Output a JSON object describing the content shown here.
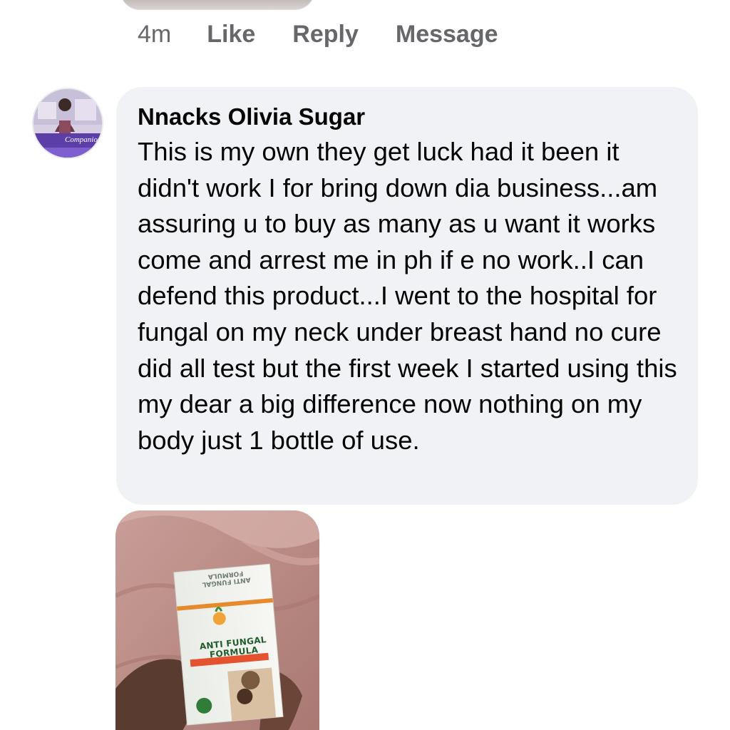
{
  "previous_comment": {
    "actions": {
      "time": "4m",
      "like": "Like",
      "reply": "Reply",
      "message": "Message"
    }
  },
  "comment": {
    "author": "Nnacks Olivia Sugar",
    "text": "This is my own they get luck had it been it didn't work I for bring down dia business...am assuring u to buy as many as u want it works come and arrest me in ph if e no work..I can defend this product...I went to the hospital for fungal on my neck under breast hand no cure did all test but the first week I started using this my dear a big difference now nothing on my body just 1 bottle of use.",
    "avatar_caption": "Companion",
    "attachment": {
      "product_label": "ANTI FUNGAL FORMULA",
      "product_label_mirrored": "ANTI FUNGAL FORMULA"
    }
  },
  "colors": {
    "bubble_bg": "#f0f2f5",
    "meta_text": "#65676b",
    "body_text": "#050505"
  },
  "icons": {
    "avatar": "profile-photo",
    "attachment": "product-photo"
  }
}
